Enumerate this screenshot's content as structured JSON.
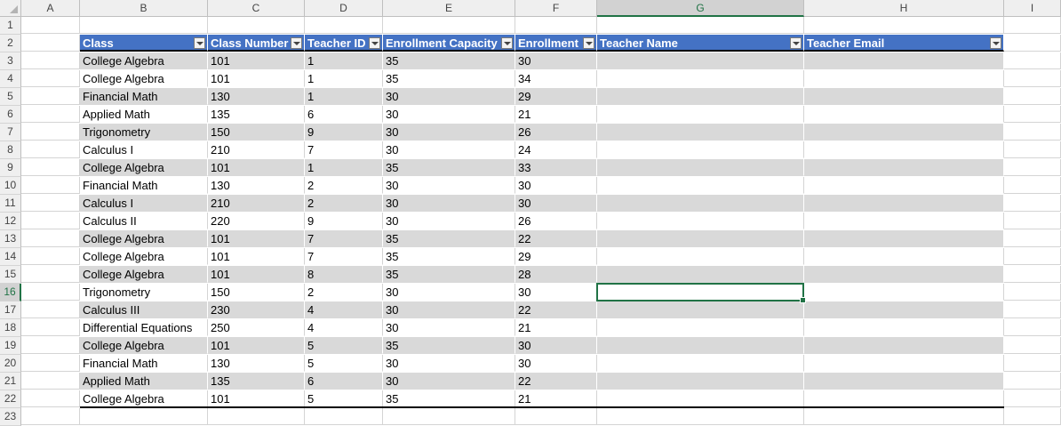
{
  "columns": [
    "",
    "A",
    "B",
    "C",
    "D",
    "E",
    "F",
    "G",
    "H",
    "I"
  ],
  "selected_column": "G",
  "selected_row": "16",
  "row_numbers": [
    "1",
    "2",
    "3",
    "4",
    "5",
    "6",
    "7",
    "8",
    "9",
    "10",
    "11",
    "12",
    "13",
    "14",
    "15",
    "16",
    "17",
    "18",
    "19",
    "20",
    "21",
    "22",
    "23"
  ],
  "table": {
    "headers": [
      "Class",
      "Class Number",
      "Teacher ID",
      "Enrollment Capacity",
      "Enrollment",
      "Teacher Name",
      "Teacher Email"
    ],
    "rows": [
      [
        "College Algebra",
        "101",
        "1",
        "35",
        "30",
        "",
        ""
      ],
      [
        "College Algebra",
        "101",
        "1",
        "35",
        "34",
        "",
        ""
      ],
      [
        "Financial Math",
        "130",
        "1",
        "30",
        "29",
        "",
        ""
      ],
      [
        "Applied Math",
        "135",
        "6",
        "30",
        "21",
        "",
        ""
      ],
      [
        "Trigonometry",
        "150",
        "9",
        "30",
        "26",
        "",
        ""
      ],
      [
        "Calculus I",
        "210",
        "7",
        "30",
        "24",
        "",
        ""
      ],
      [
        "College Algebra",
        "101",
        "1",
        "35",
        "33",
        "",
        ""
      ],
      [
        "Financial Math",
        "130",
        "2",
        "30",
        "30",
        "",
        ""
      ],
      [
        "Calculus I",
        "210",
        "2",
        "30",
        "30",
        "",
        ""
      ],
      [
        "Calculus II",
        "220",
        "9",
        "30",
        "26",
        "",
        ""
      ],
      [
        "College Algebra",
        "101",
        "7",
        "35",
        "22",
        "",
        ""
      ],
      [
        "College Algebra",
        "101",
        "7",
        "35",
        "29",
        "",
        ""
      ],
      [
        "College Algebra",
        "101",
        "8",
        "35",
        "28",
        "",
        ""
      ],
      [
        "Trigonometry",
        "150",
        "2",
        "30",
        "30",
        "",
        ""
      ],
      [
        "Calculus III",
        "230",
        "4",
        "30",
        "22",
        "",
        ""
      ],
      [
        "Differential Equations",
        "250",
        "4",
        "30",
        "21",
        "",
        ""
      ],
      [
        "College Algebra",
        "101",
        "5",
        "35",
        "30",
        "",
        ""
      ],
      [
        "Financial Math",
        "130",
        "5",
        "30",
        "30",
        "",
        ""
      ],
      [
        "Applied Math",
        "135",
        "6",
        "30",
        "22",
        "",
        ""
      ],
      [
        "College Algebra",
        "101",
        "5",
        "35",
        "21",
        "",
        ""
      ]
    ]
  },
  "colors": {
    "header_fill": "#4472c4",
    "band_fill": "#d9d9d9",
    "selection": "#217346"
  }
}
